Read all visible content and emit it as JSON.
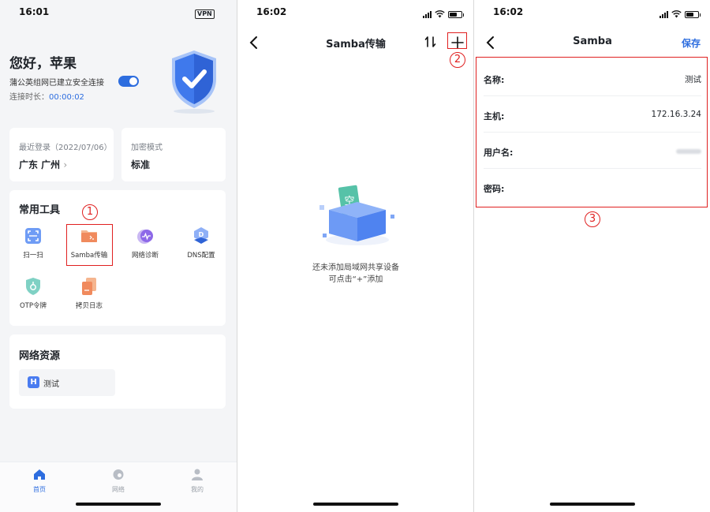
{
  "panel1": {
    "status_time": "16:01",
    "vpn_badge": "VPN",
    "greeting": "您好，苹果",
    "connection_text": "蒲公英组网已建立安全连接",
    "connected": true,
    "duration_label": "连接时长：",
    "duration_value": "00:00:02",
    "last_login_label": "最近登录（2022/07/06）",
    "last_login_location": "广东 广州",
    "encrypt_label": "加密模式",
    "encrypt_value": "标准",
    "tools_title": "常用工具",
    "tools": [
      {
        "label": "扫一扫",
        "icon": "scan-icon"
      },
      {
        "label": "Samba传输",
        "icon": "samba-folder-icon"
      },
      {
        "label": "网络诊断",
        "icon": "network-diagnosis-icon"
      },
      {
        "label": "DNS配置",
        "icon": "dns-config-icon"
      },
      {
        "label": "OTP令牌",
        "icon": "otp-token-icon"
      },
      {
        "label": "拷贝日志",
        "icon": "copy-log-icon"
      }
    ],
    "resources_title": "网络资源",
    "resource_badge": "H",
    "resource_name": "测试",
    "tabs": [
      {
        "label": "首页",
        "icon": "home-icon",
        "active": true
      },
      {
        "label": "网络",
        "icon": "network-icon",
        "active": false
      },
      {
        "label": "我的",
        "icon": "profile-icon",
        "active": false
      }
    ],
    "annotation": "1"
  },
  "panel2": {
    "status_time": "16:02",
    "title": "Samba传输",
    "empty_illustration_text": "空",
    "empty_line1": "还未添加局域网共享设备",
    "empty_line2": "可点击“+”添加",
    "annotation": "2"
  },
  "panel3": {
    "status_time": "16:02",
    "title": "Samba",
    "save_label": "保存",
    "fields": [
      {
        "label": "名称:",
        "value": "测试"
      },
      {
        "label": "主机:",
        "value": "172.16.3.24"
      },
      {
        "label": "用户名:",
        "value": ""
      },
      {
        "label": "密码:",
        "value": ""
      }
    ],
    "annotation": "3"
  },
  "colors": {
    "accent": "#2d6ddf",
    "annotation_red": "#e02020",
    "background": "#f4f5f7"
  }
}
